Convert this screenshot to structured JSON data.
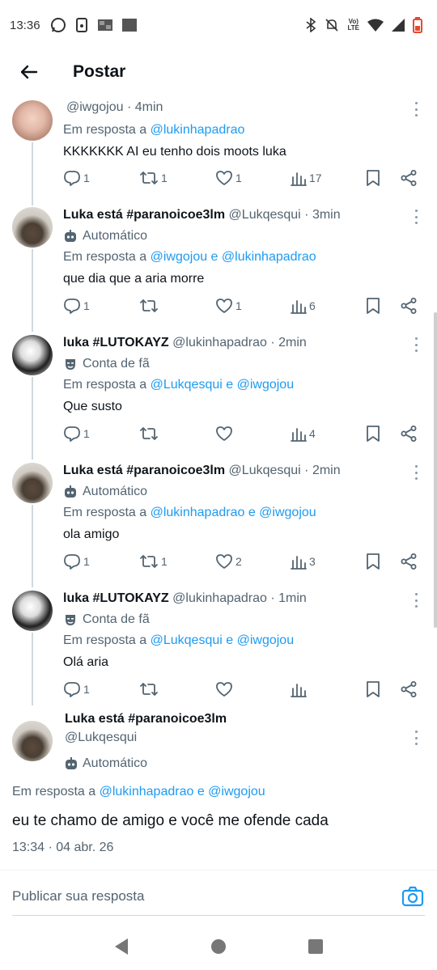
{
  "status_bar": {
    "time": "13:36",
    "network_label_top": "Vo)",
    "network_label_bottom": "LTE",
    "icons_left": [
      "whatsapp-icon",
      "phone-cast-icon",
      "image-icon",
      "square-icon"
    ],
    "icons_right": [
      "bluetooth-icon",
      "mute-icon",
      "volte-icon",
      "wifi-icon",
      "signal-icon",
      "battery-icon"
    ]
  },
  "header": {
    "title": "Postar"
  },
  "tweets": [
    {
      "name": "",
      "handle": "@iwgojou",
      "time": "4min",
      "badge": "",
      "reply_prefix": "Em resposta a",
      "reply_links": "@lukinhapadrao",
      "text": "KKKKKKK AI eu tenho dois moots luka",
      "replies": "1",
      "retweets": "1",
      "likes": "1",
      "views": "17"
    },
    {
      "name": "Luka está #paranoicoe3lm",
      "handle": "@Lukqesqui",
      "time": "3min",
      "badge": "Automático",
      "reply_prefix": "Em resposta a",
      "reply_links": "@iwgojou e @lukinhapadrao",
      "text": "que dia que a aria morre",
      "replies": "1",
      "retweets": "",
      "likes": "1",
      "views": "6"
    },
    {
      "name": "luka #LUTOKAYZ",
      "handle": "@lukinhapadrao",
      "time": "2min",
      "badge": "Conta de fã",
      "reply_prefix": "Em resposta a",
      "reply_links": "@Lukqesqui e @iwgojou",
      "text": "Que susto",
      "replies": "1",
      "retweets": "",
      "likes": "",
      "views": "4"
    },
    {
      "name": "Luka está #paranoicoe3lm",
      "handle": "@Lukqesqui",
      "time": "2min",
      "badge": "Automático",
      "reply_prefix": "Em resposta a",
      "reply_links": "@lukinhapadrao e @iwgojou",
      "text": "ola amigo",
      "replies": "1",
      "retweets": "1",
      "likes": "2",
      "views": "3"
    },
    {
      "name": "luka #LUTOKAYZ",
      "handle": "@lukinhapadrao",
      "time": "1min",
      "badge": "Conta de fã",
      "reply_prefix": "Em resposta a",
      "reply_links": "@Lukqesqui e @iwgojou",
      "text": "Olá aria",
      "replies": "1",
      "retweets": "",
      "likes": "",
      "views": ""
    }
  ],
  "main_tweet": {
    "name": "Luka está #paranoicoe3lm",
    "handle": "@Lukqesqui",
    "badge": "Automático",
    "reply_prefix": "Em resposta a",
    "reply_links": "@lukinhapadrao e @iwgojou",
    "text": "eu te chamo de amigo e você me ofende cada",
    "timestamp": "13:34 · 04 abr. 26"
  },
  "compose": {
    "placeholder": "Publicar sua resposta"
  },
  "colors": {
    "link": "#1d9bf0",
    "secondary": "#536471",
    "text": "#0f1419"
  }
}
